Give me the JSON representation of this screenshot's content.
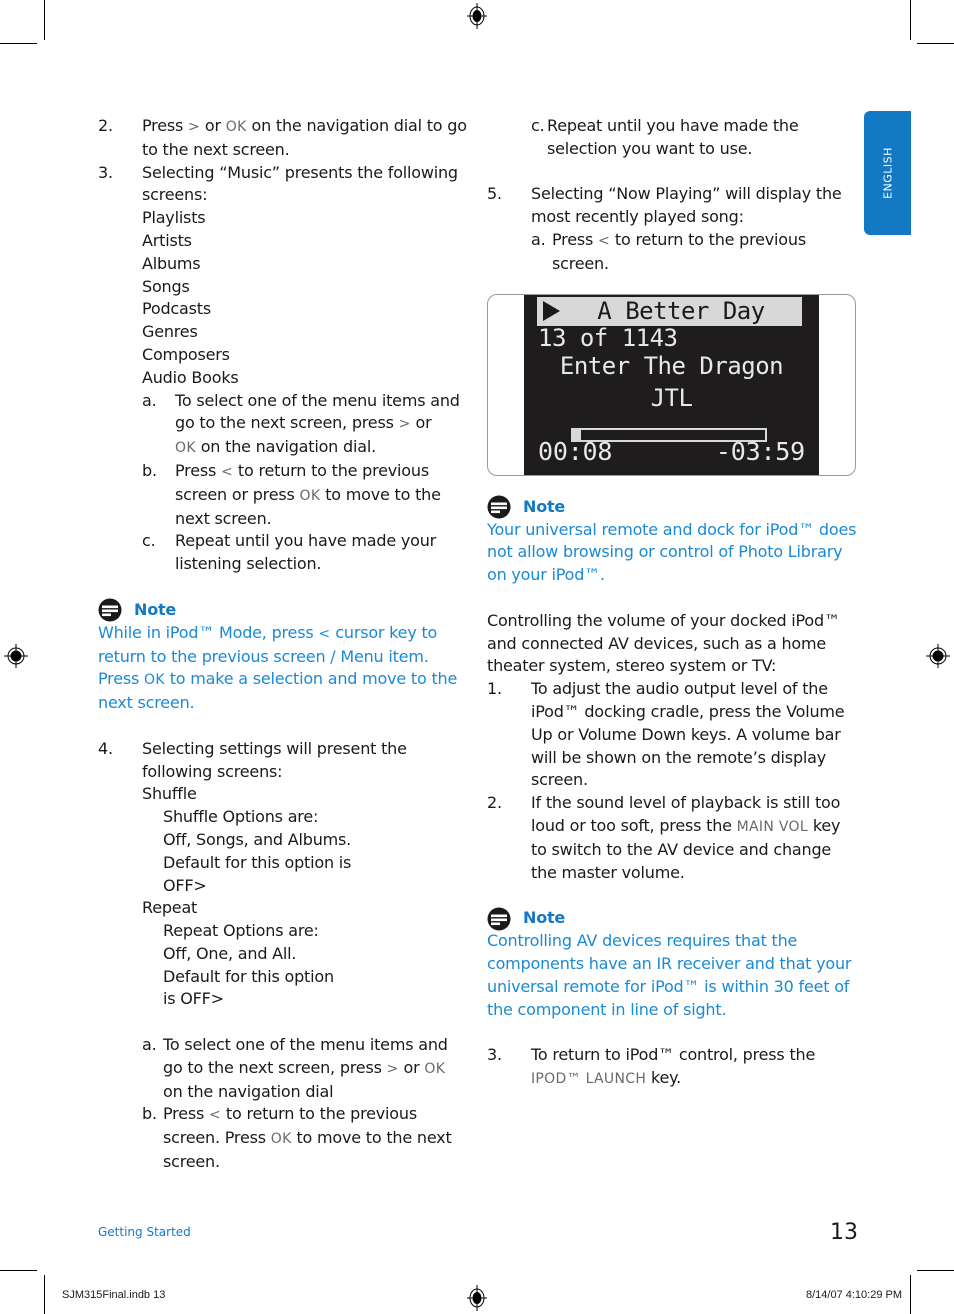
{
  "language_tab": "ENGLISH",
  "left_column": {
    "item2": {
      "num": "2.",
      "text_before": "Press ",
      "key1": ">",
      "text_mid": " or ",
      "key2": "OK",
      "text_after": " on the navigation dial to go to the next screen."
    },
    "item3": {
      "num": "3.",
      "text": "Selecting “Music” presents the following screens:",
      "screens": [
        "Playlists",
        "Artists",
        "Albums",
        "Songs",
        "Podcasts",
        "Genres",
        "Composers",
        "Audio Books"
      ],
      "subs": [
        {
          "label": "a.",
          "p1": "To select one of the menu items and go to the next screen, press ",
          "k1": ">",
          "p2": " or ",
          "k2": "OK",
          "p3": " on the navigation dial."
        },
        {
          "label": "b.",
          "p1": "Press ",
          "k1": "<",
          "p2": " to return to the previous screen or press ",
          "k2": "OK",
          "p3": " to move to the next screen."
        },
        {
          "label": "c.",
          "p1": "Repeat until you have made your listening selection."
        }
      ]
    },
    "note": {
      "title": "Note",
      "p1": "While in iPod™ Mode, press ",
      "k1": "<",
      "p2": " cursor key to return to the previous screen / Menu item. Press ",
      "k2": "OK",
      "p3": " to make a selection and move to the next screen."
    },
    "item4": {
      "num": "4.",
      "text": "Selecting settings will present the following screens:",
      "shuffle": {
        "title": "Shuffle",
        "lines": [
          "Shuffle Options are:",
          "Off, Songs, and Albums.",
          "Default for this option is",
          "OFF>"
        ]
      },
      "repeat": {
        "title": "Repeat",
        "lines": [
          "Repeat Options are:",
          "Off, One, and All.",
          "Default for this option",
          "is OFF>"
        ]
      },
      "subs": [
        {
          "label": "a.",
          "p1": "To select one of the menu items and go to the next screen, press ",
          "k1": ">",
          "p2": " or ",
          "k2": "OK",
          "p3": " on the navigation dial"
        },
        {
          "label": "b.",
          "p1": "Press ",
          "k1": "<",
          "p2": " to return to the previous screen.  Press ",
          "k2": "OK",
          "p3": " to move to the next screen."
        }
      ]
    }
  },
  "right_column": {
    "sub_c": {
      "label": "c.",
      "text": "Repeat until you have made the selection you want to use."
    },
    "item5": {
      "num": "5.",
      "text": "Selecting “Now Playing” will display the most recently played song:",
      "sub_a": {
        "label": "a.",
        "p1": "Press ",
        "k1": "<",
        "p2": " to return to the previous screen."
      }
    },
    "lcd": {
      "title": "A Better Day",
      "track_count": "13 of 1143",
      "song": "Enter The Dragon",
      "artist": "JTL",
      "progress_percent": 4,
      "elapsed": "00:08",
      "remaining": "-03:59"
    },
    "note1": {
      "title": "Note",
      "text": "Your universal remote and dock for iPod™ does not allow browsing or control of Photo Library on your iPod™."
    },
    "volume_intro": "Controlling the volume of your docked iPod™ and connected AV devices, such as a home theater system, stereo system or TV:",
    "vol_items": [
      {
        "num": "1.",
        "p1": "To adjust the audio output level of the iPod™ docking cradle, press the Volume Up or Volume Down keys.  A volume bar will be shown on the remote’s display screen."
      },
      {
        "num": "2.",
        "p1": "If the sound level of playback is still too loud or too soft, press the ",
        "k1": "MAIN VOL",
        "p2": " key to switch to the AV device and change the master volume."
      }
    ],
    "note2": {
      "title": "Note",
      "text": "Controlling AV devices requires that the components have an IR receiver and that your universal remote for iPod™ is within 30 feet of the component in line of sight."
    },
    "item3": {
      "num": "3.",
      "p1": "To return to iPod™ control, press the ",
      "k1": "IPOD™ LAUNCH",
      "p2": " key."
    }
  },
  "footer": {
    "section": "Getting Started",
    "page_number": "13",
    "slug_left": "SJM315Final.indb   13",
    "slug_right": "8/14/07   4:10:29 PM"
  }
}
